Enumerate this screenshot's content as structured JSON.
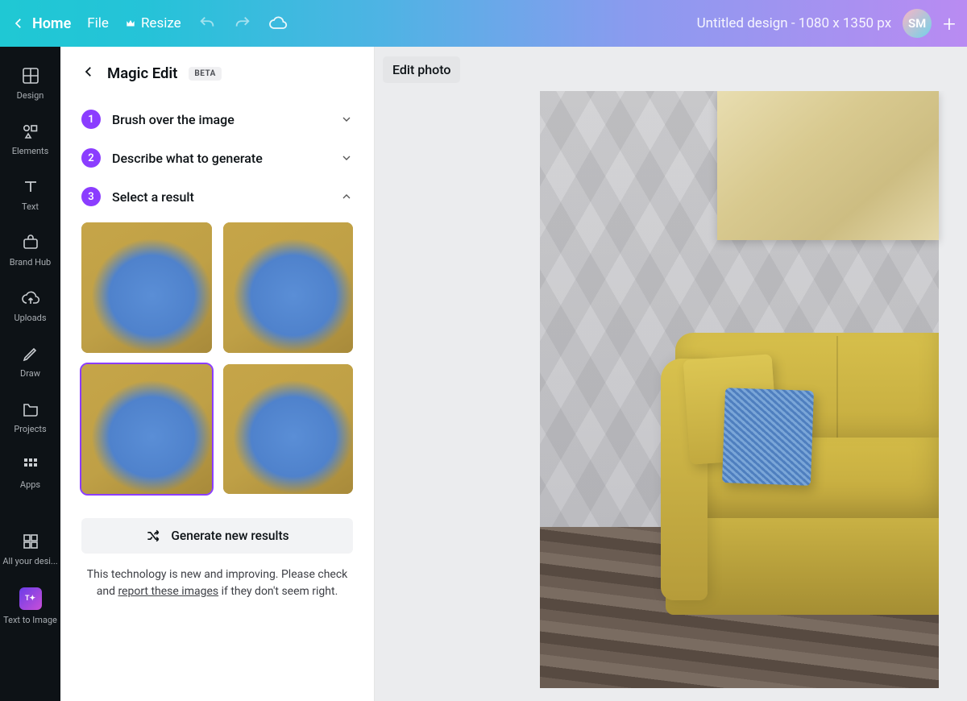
{
  "topbar": {
    "home": "Home",
    "file": "File",
    "resize": "Resize",
    "doc_title": "Untitled design - 1080 x 1350 px",
    "avatar_initials": "SM"
  },
  "rail": {
    "items": [
      {
        "label": "Design"
      },
      {
        "label": "Elements"
      },
      {
        "label": "Text"
      },
      {
        "label": "Brand Hub"
      },
      {
        "label": "Uploads"
      },
      {
        "label": "Draw"
      },
      {
        "label": "Projects"
      },
      {
        "label": "Apps"
      },
      {
        "label": "All your desi..."
      },
      {
        "label": "Text to Image"
      }
    ]
  },
  "panel": {
    "title": "Magic Edit",
    "badge": "BETA",
    "steps": [
      {
        "num": "1",
        "label": "Brush over the image",
        "expanded": false
      },
      {
        "num": "2",
        "label": "Describe what to generate",
        "expanded": false
      },
      {
        "num": "3",
        "label": "Select a result",
        "expanded": true
      }
    ],
    "results": [
      {
        "selected": false
      },
      {
        "selected": false
      },
      {
        "selected": true
      },
      {
        "selected": false
      }
    ],
    "generate_label": "Generate new results",
    "disclaimer_pre": "This technology is new and improving. Please check and ",
    "disclaimer_link": "report these images",
    "disclaimer_post": " if they don't seem right."
  },
  "canvas": {
    "edit_photo": "Edit photo"
  }
}
